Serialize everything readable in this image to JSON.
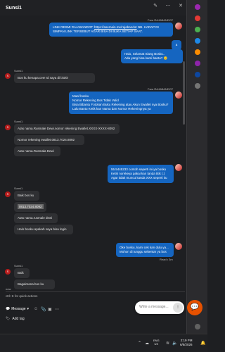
{
  "header": {
    "title": "Sunsi1"
  },
  "messages": {
    "m1": {
      "sender": "Fara RAJABANDOT",
      "line1": "LINK RESMI RAJABANDOT: ",
      "link": "https://asemain.me/rajabandot",
      "line1b": " NB. HARAP DI",
      "line2": "SIMPAN LINK TERSEBUT AGAR BISA DI BUKA SETIAP SAAT."
    },
    "m2": {
      "text": "a"
    },
    "m3": {
      "line1": "Halo, Selamat Siang Bosku..",
      "line2": "Ada yang bisa kami bantu? 😊"
    },
    "m4": {
      "sender": "Sunsi1",
      "text": "Bos ku kenapa.cee! Id saya di blokir"
    },
    "m5": {
      "sender": "Fara RAJABANDOT",
      "line1": "Maaf bosku",
      "line2": "Nomor Rekening Bos Tidak Valid",
      "line3": "Bisa Bibantu Fotokan Buku Rekening atau Akun Ewallet nya Bosku?",
      "line4": "Lalu Bantu Ketik kan Nama dan Nomor Rekeningnya ya"
    },
    "m6": {
      "sender": "Sunsi1",
      "text1": "Atas nama.Rusmale Dewi.nomor rekening Ewallet.XXXX-XXXX-8092",
      "text2": "Nomor rekening ewallet.0813.7024.8092",
      "text3": "Atas nama.Rusmala Dewi"
    },
    "m7": {
      "line1": "55.5445233 contoh seperti ini ya bosku",
      "line2": "Ketik norekeya pakai kan tanda titik (.)",
      "line3": "Agar tidak muncul tanda XXX seperti itu"
    },
    "m8": {
      "sender": "Sunsi1",
      "text1": "Baik bos ku",
      "text2": "0813.7024.8092",
      "text3": "Atas nama.rusmale dewi",
      "text4": "Halo bosku apakah saya bisa login"
    },
    "m9": {
      "line1": "Oke bosku, kami cek kan dulu ya...",
      "line2": "Mohon di tunggu sebentar ya bos",
      "read": "Read • 3m"
    },
    "m10": {
      "sender": "Sunsi1",
      "text1": "Baik",
      "text2": "Bagaimana bos ku",
      "time": "now"
    }
  },
  "composer": {
    "placeholder": "ctrl+K for quick actions",
    "message_label": "Message",
    "send_label": "Send",
    "add_tag_label": "Add tag"
  },
  "widget": {
    "placeholder": "Write a message..."
  },
  "taskbar": {
    "lang1": "ENG",
    "lang2": "US",
    "time": "2:19 PM",
    "date": "6/8/2026"
  },
  "colors": {
    "accent": "#1565c0",
    "fab": "#e65100",
    "avatar": "#b71c1c"
  }
}
